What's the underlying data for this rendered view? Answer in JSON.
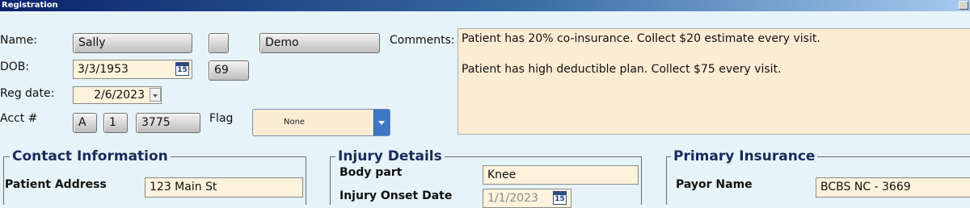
{
  "window": {
    "title": "Registration"
  },
  "patient": {
    "name_label": "Name:",
    "first_name": "Sally",
    "middle_initial": "",
    "last_name": "Demo",
    "dob_label": "DOB:",
    "dob": "3/3/1953",
    "age": "69",
    "reg_date_label": "Reg date:",
    "reg_date": "2/6/2023",
    "acct_label": "Acct #",
    "acct_prefix": "A",
    "acct_mid": "1",
    "acct_number": "3775",
    "flag_label": "Flag",
    "flag_value": "None"
  },
  "comments": {
    "label": "Comments:",
    "line1": "Patient has 20% co-insurance. Collect $20 estimate every visit.",
    "line2": "Patient has high deductible plan. Collect $75 every visit."
  },
  "contact": {
    "heading": "Contact Information",
    "address_label": "Patient Address",
    "address": "123 Main St"
  },
  "injury": {
    "heading": "Injury Details",
    "body_part_label": "Body part",
    "body_part": "Knee",
    "onset_label": "Injury Onset Date",
    "onset_date": "1/1/2023"
  },
  "insurance": {
    "heading": "Primary Insurance",
    "payor_label": "Payor Name",
    "payor": "BCBS NC  - 3669"
  },
  "icons": {
    "calendar": "calendar-icon",
    "dropdown": "chevron-down-icon"
  },
  "colors": {
    "field_bg": "#fdf2dc",
    "form_bg": "#e6f3f8",
    "heading": "#1a2a5a",
    "select_accent": "#3d78c6"
  }
}
